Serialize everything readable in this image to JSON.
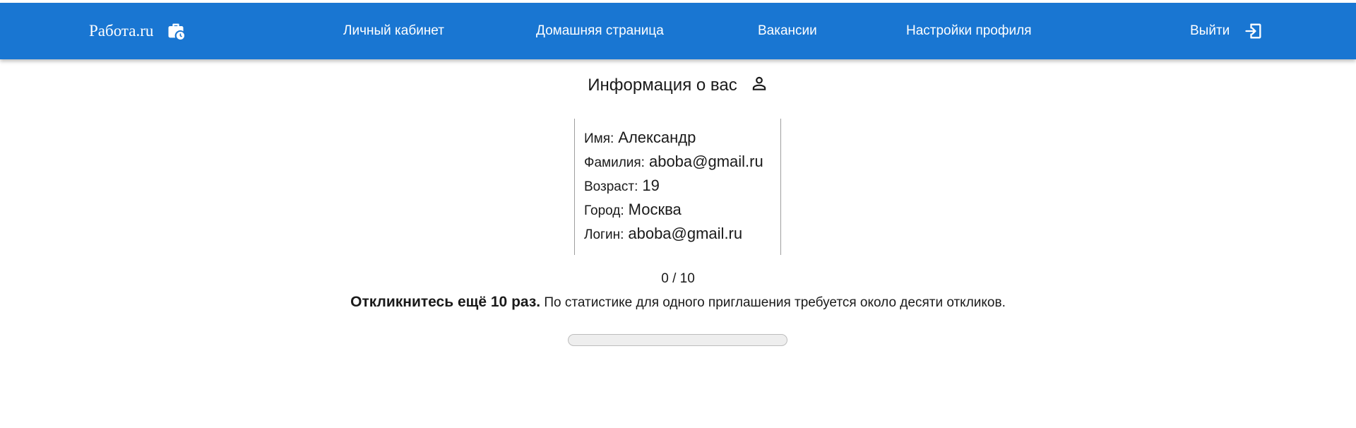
{
  "header": {
    "brand": "Работа.ru",
    "brand_icon": "briefcase-clock-icon",
    "nav": {
      "cabinet": "Личный кабинет",
      "home": "Домашняя страница",
      "vacancies": "Вакансии",
      "settings": "Настройки профиля"
    },
    "logout": "Выйти",
    "logout_icon": "logout-icon",
    "color": "#1976d2"
  },
  "profile": {
    "title": "Информация о вас",
    "title_icon": "person-icon",
    "fields": [
      {
        "label": "Имя:",
        "value": "Александр"
      },
      {
        "label": "Фамилия:",
        "value": "aboba@gmail.ru"
      },
      {
        "label": "Возраст:",
        "value": "19"
      },
      {
        "label": "Город:",
        "value": "Москва"
      },
      {
        "label": "Логин:",
        "value": "aboba@gmail.ru"
      }
    ]
  },
  "responses": {
    "counter": "0 / 10",
    "progress_fraction": 0,
    "hint_bold": "Откликнитесь ещё 10 раз.",
    "hint_text": " По статистике для одного приглашения требуется около десяти откликов."
  }
}
